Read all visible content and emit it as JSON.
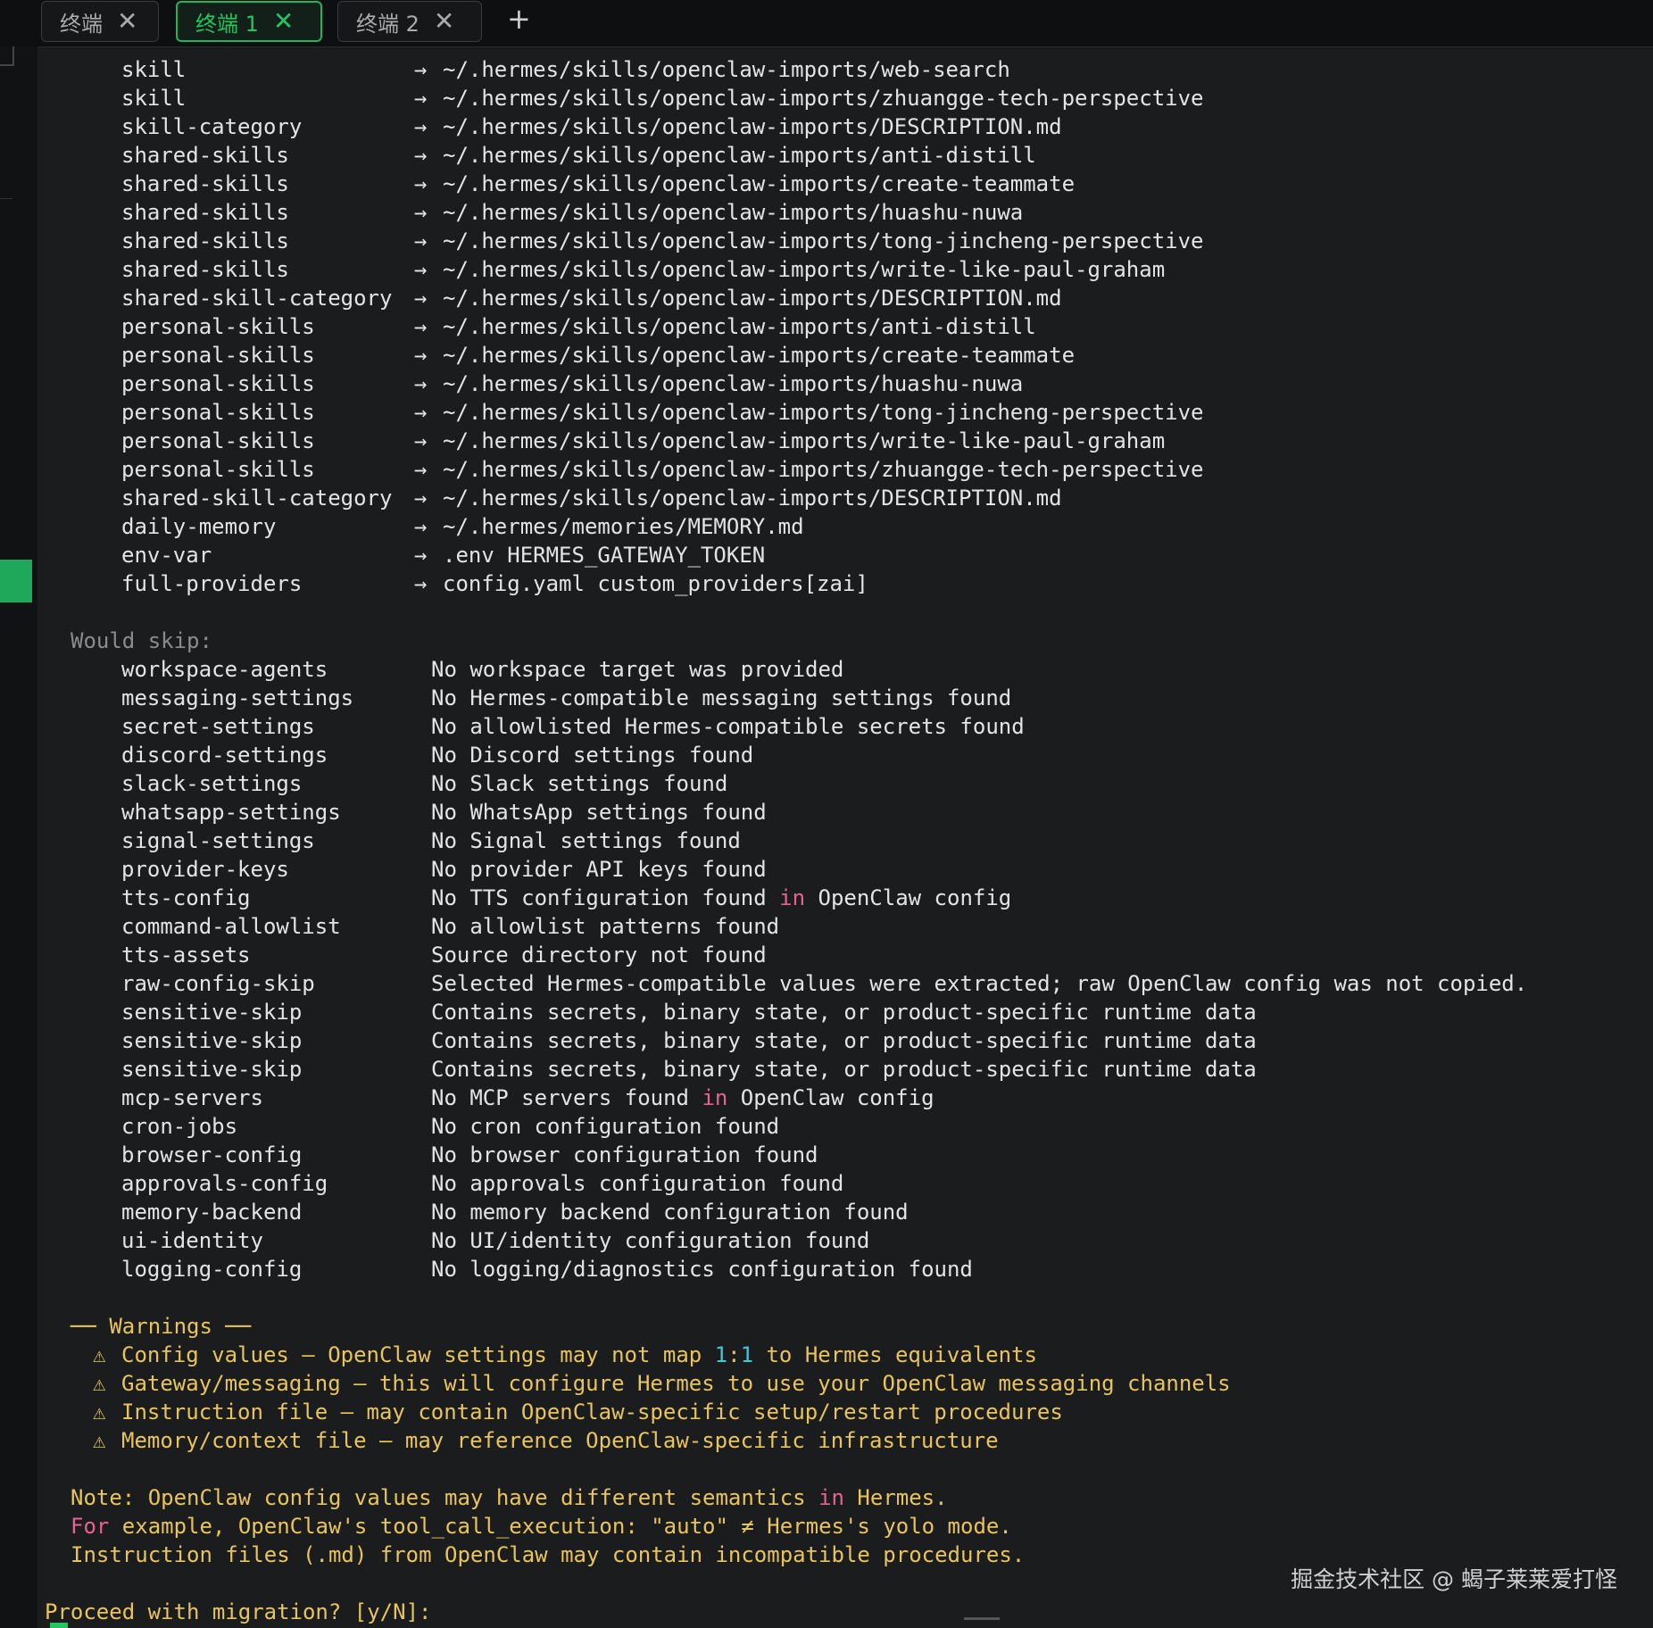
{
  "tabs": [
    {
      "label": "终端",
      "active": false
    },
    {
      "label": "终端  1",
      "active": true
    },
    {
      "label": "终端  2",
      "active": false
    }
  ],
  "new_tab_icon": "+",
  "close_icon": "✕",
  "mappings": [
    {
      "key": "skill",
      "target": "~/.hermes/skills/openclaw-imports/web-search"
    },
    {
      "key": "skill",
      "target": "~/.hermes/skills/openclaw-imports/zhuangge-tech-perspective"
    },
    {
      "key": "skill-category",
      "target": "~/.hermes/skills/openclaw-imports/DESCRIPTION.md"
    },
    {
      "key": "shared-skills",
      "target": "~/.hermes/skills/openclaw-imports/anti-distill"
    },
    {
      "key": "shared-skills",
      "target": "~/.hermes/skills/openclaw-imports/create-teammate"
    },
    {
      "key": "shared-skills",
      "target": "~/.hermes/skills/openclaw-imports/huashu-nuwa"
    },
    {
      "key": "shared-skills",
      "target": "~/.hermes/skills/openclaw-imports/tong-jincheng-perspective"
    },
    {
      "key": "shared-skills",
      "target": "~/.hermes/skills/openclaw-imports/write-like-paul-graham"
    },
    {
      "key": "shared-skill-category",
      "target": "~/.hermes/skills/openclaw-imports/DESCRIPTION.md"
    },
    {
      "key": "personal-skills",
      "target": "~/.hermes/skills/openclaw-imports/anti-distill"
    },
    {
      "key": "personal-skills",
      "target": "~/.hermes/skills/openclaw-imports/create-teammate"
    },
    {
      "key": "personal-skills",
      "target": "~/.hermes/skills/openclaw-imports/huashu-nuwa"
    },
    {
      "key": "personal-skills",
      "target": "~/.hermes/skills/openclaw-imports/tong-jincheng-perspective"
    },
    {
      "key": "personal-skills",
      "target": "~/.hermes/skills/openclaw-imports/write-like-paul-graham"
    },
    {
      "key": "personal-skills",
      "target": "~/.hermes/skills/openclaw-imports/zhuangge-tech-perspective"
    },
    {
      "key": "shared-skill-category",
      "target": "~/.hermes/skills/openclaw-imports/DESCRIPTION.md"
    },
    {
      "key": "daily-memory",
      "target": "~/.hermes/memories/MEMORY.md"
    },
    {
      "key": "env-var",
      "target": ".env HERMES_GATEWAY_TOKEN"
    },
    {
      "key": "full-providers",
      "target": "config.yaml custom_providers[zai]"
    }
  ],
  "arrow": "→",
  "skip_heading": "Would skip:",
  "skips": [
    {
      "key": "workspace-agents",
      "reason": "No workspace target was provided"
    },
    {
      "key": "messaging-settings",
      "reason": "No Hermes-compatible messaging settings found"
    },
    {
      "key": "secret-settings",
      "reason": "No allowlisted Hermes-compatible secrets found"
    },
    {
      "key": "discord-settings",
      "reason": "No Discord settings found"
    },
    {
      "key": "slack-settings",
      "reason": "No Slack settings found"
    },
    {
      "key": "whatsapp-settings",
      "reason": "No WhatsApp settings found"
    },
    {
      "key": "signal-settings",
      "reason": "No Signal settings found"
    },
    {
      "key": "provider-keys",
      "reason": "No provider API keys found"
    },
    {
      "key": "tts-config",
      "reason_pre": "No TTS configuration found ",
      "reason_kw": "in",
      "reason_post": " OpenClaw config"
    },
    {
      "key": "command-allowlist",
      "reason": "No allowlist patterns found"
    },
    {
      "key": "tts-assets",
      "reason": "Source directory not found"
    },
    {
      "key": "raw-config-skip",
      "reason": "Selected Hermes-compatible values were extracted; raw OpenClaw config was not copied."
    },
    {
      "key": "sensitive-skip",
      "reason": "Contains secrets, binary state, or product-specific runtime data"
    },
    {
      "key": "sensitive-skip",
      "reason": "Contains secrets, binary state, or product-specific runtime data"
    },
    {
      "key": "sensitive-skip",
      "reason": "Contains secrets, binary state, or product-specific runtime data"
    },
    {
      "key": "mcp-servers",
      "reason_pre": "No MCP servers found ",
      "reason_kw": "in",
      "reason_post": " OpenClaw config"
    },
    {
      "key": "cron-jobs",
      "reason": "No cron configuration found"
    },
    {
      "key": "browser-config",
      "reason": "No browser configuration found"
    },
    {
      "key": "approvals-config",
      "reason": "No approvals configuration found"
    },
    {
      "key": "memory-backend",
      "reason": "No memory backend configuration found"
    },
    {
      "key": "ui-identity",
      "reason": "No UI/identity configuration found"
    },
    {
      "key": "logging-config",
      "reason": "No logging/diagnostics configuration found"
    }
  ],
  "warnings_heading": "── Warnings ──",
  "warning_icon": "⚠",
  "warnings": {
    "w1_pre": "Config values — OpenClaw settings may not map ",
    "w1_n1": "1",
    "w1_colon": ":",
    "w1_n2": "1",
    "w1_post": " to Hermes equivalents",
    "w2": "Gateway/messaging — this will configure Hermes to use your OpenClaw messaging channels",
    "w3": "Instruction file — may contain OpenClaw-specific setup/restart procedures",
    "w4": "Memory/context file — may reference OpenClaw-specific infrastructure"
  },
  "note": {
    "l1_pre": "Note: OpenClaw config values may have different semantics ",
    "l1_kw": "in",
    "l1_post": " Hermes.",
    "l2_kw": "For",
    "l2_post": " example, OpenClaw's tool_call_execution: \"auto\" ≠ Hermes's yolo mode.",
    "l3": "Instruction files (.md) from OpenClaw may contain incompatible procedures."
  },
  "prompt": "Proceed with migration? [y/N]:",
  "watermark": "掘金技术社区 @ 蝎子莱莱爱打怪",
  "colors": {
    "accent": "#22c55e",
    "warning": "#e8c45c",
    "keyword": "#e8628f",
    "number": "#42c8d6",
    "background": "#1b1c1e"
  }
}
